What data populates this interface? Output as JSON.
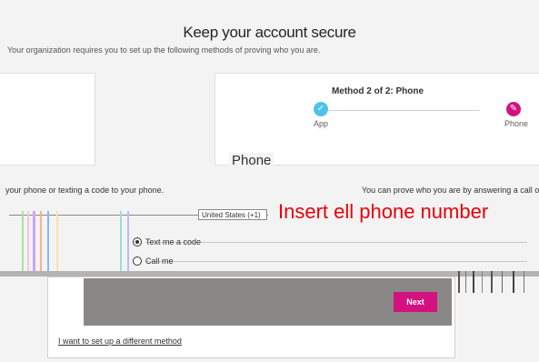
{
  "header": {
    "title": "Keep your account secure",
    "subtitle": "Your organization requires you to set up the following methods of proving who you are."
  },
  "wizard": {
    "method_label": "Method 2 of 2: Phone",
    "steps": [
      {
        "label": "App",
        "state": "complete",
        "icon": "check-icon",
        "color": "#4ec2e8"
      },
      {
        "label": "Phone",
        "state": "current",
        "icon": "pencil-icon",
        "color": "#d4127f"
      }
    ]
  },
  "phone": {
    "heading": "Phone",
    "description_left": "your phone or texting a code to your phone.",
    "description_right": "You can prove who you are by answering a call or",
    "country": "United States (+1)",
    "annotation": "Insert   ell phone number",
    "options": [
      {
        "label": "Text me a code",
        "checked": true
      },
      {
        "label": "Call me",
        "checked": false
      }
    ]
  },
  "footer": {
    "next_label": "Next",
    "different_method_label": "I want to set up a different method"
  },
  "colors": {
    "accent": "#d4127f",
    "complete": "#4ec2e8",
    "annotation": "#e8000b"
  }
}
